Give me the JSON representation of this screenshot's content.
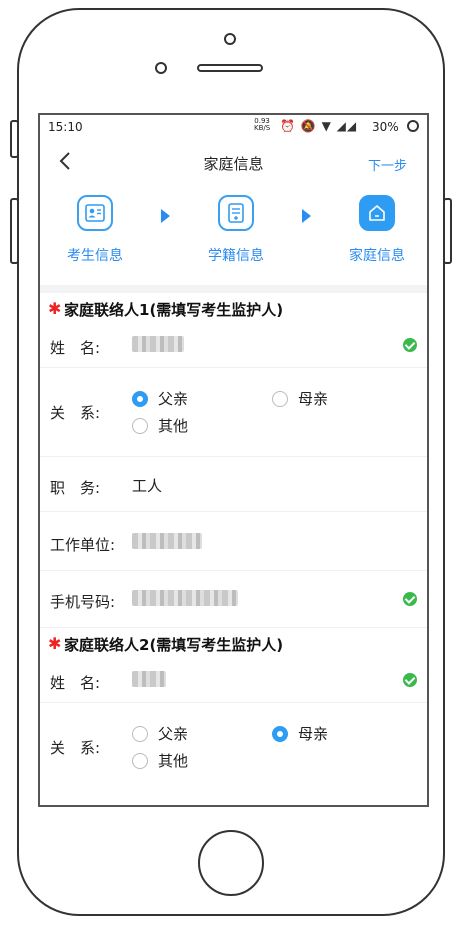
{
  "status": {
    "time": "15:10",
    "rate_value": "0.93",
    "rate_unit": "KB/S",
    "icons": [
      "alarm-icon",
      "mute-icon",
      "wifi-icon",
      "signal-icon",
      "signal-icon"
    ],
    "battery": "30%"
  },
  "nav": {
    "title": "家庭信息",
    "next": "下一步"
  },
  "steps": [
    {
      "label": "考生信息",
      "icon": "student-card-icon"
    },
    {
      "label": "学籍信息",
      "icon": "record-icon"
    },
    {
      "label": "家庭信息",
      "icon": "home-icon",
      "active": true
    }
  ],
  "contact1": {
    "header": "家庭联络人1(需填写考生监护人)",
    "name_label": "姓　名:",
    "relation_label": "关　系:",
    "relation_options": [
      "父亲",
      "母亲",
      "其他"
    ],
    "relation_selected": "父亲",
    "job_label": "职　务:",
    "job_value": "工人",
    "employer_label": "工作单位:",
    "phone_label": "手机号码:"
  },
  "contact2": {
    "header": "家庭联络人2(需填写考生监护人)",
    "name_label": "姓　名:",
    "relation_label": "关　系:",
    "relation_options": [
      "父亲",
      "母亲",
      "其他"
    ],
    "relation_selected": "母亲"
  },
  "colors": {
    "accent": "#2e9cf3",
    "required": "#e22222",
    "valid": "#3cb94c"
  }
}
